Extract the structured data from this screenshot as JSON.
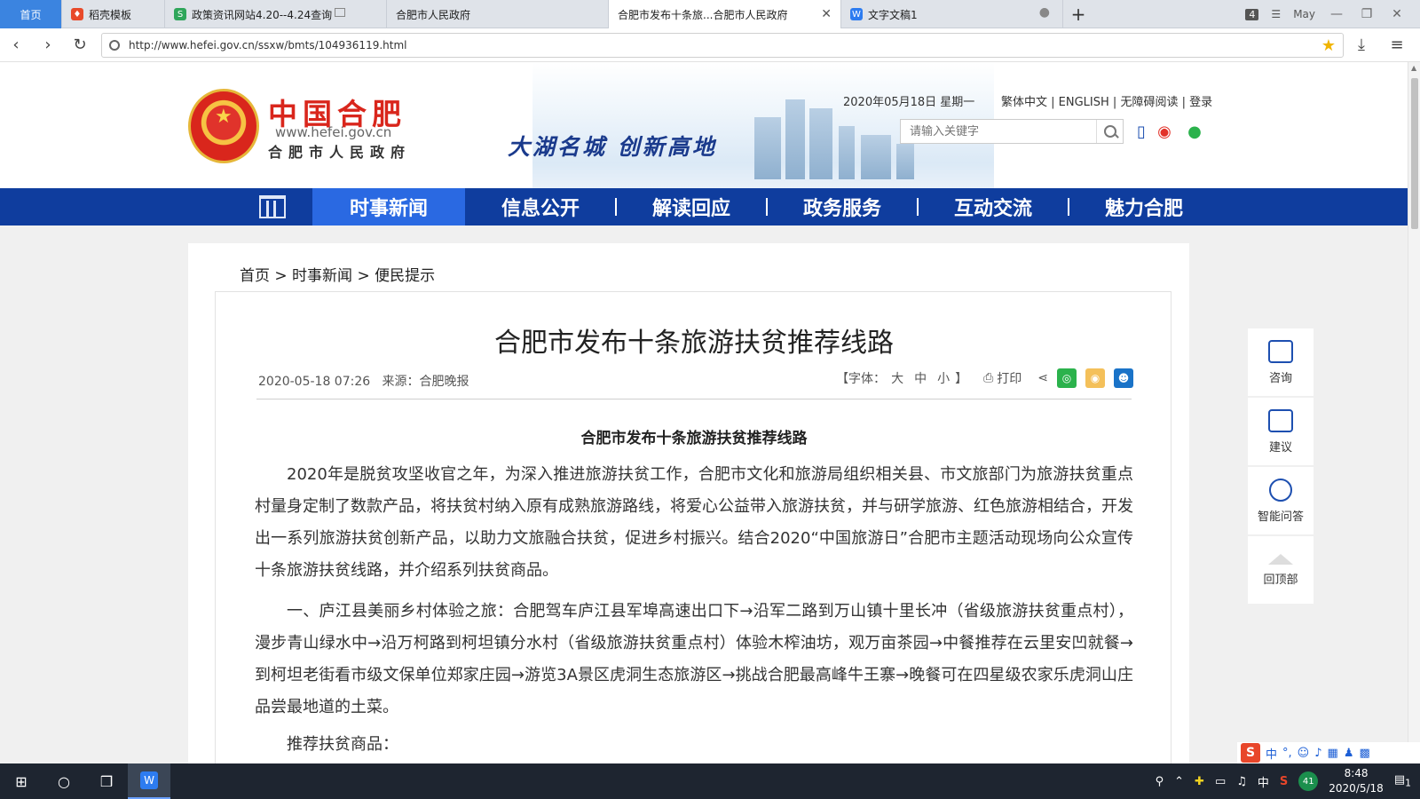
{
  "browser": {
    "tabs": [
      {
        "label": "首页",
        "icon": "home-tab",
        "color": "#3b84e0"
      },
      {
        "label": "稻壳模板",
        "icon": "docer-icon",
        "color": "#e84a2a"
      },
      {
        "label": "政策资讯网站4.20--4.24查询",
        "icon": "sheet-icon",
        "color": "#2fa65b"
      },
      {
        "label": "合肥市人民政府",
        "icon": "page-icon",
        "color": ""
      },
      {
        "label": "合肥市发布十条旅...合肥市人民政府",
        "icon": "page-icon",
        "color": ""
      },
      {
        "label": "文字文稿1",
        "icon": "wps-writer-icon",
        "color": "#2d7cf0"
      }
    ],
    "tab_count": "4",
    "user_name": "May",
    "url": "http://www.hefei.gov.cn/ssxw/bmts/104936119.html"
  },
  "site": {
    "logo_title": "中国合肥",
    "logo_url": "www.hefei.gov.cn",
    "logo_subtitle": "合肥市人民政府",
    "slogan": "大湖名城  创新高地",
    "date": "2020年05月18日 星期一",
    "links": [
      "繁体中文",
      "ENGLISH",
      "无障碍阅读",
      "登录"
    ],
    "search_placeholder": "请输入关键字",
    "nav": [
      "时事新闻",
      "信息公开",
      "解读回应",
      "政务服务",
      "互动交流",
      "魅力合肥"
    ],
    "nav_active": "时事新闻",
    "brand_blue": "#0f3d9e",
    "accent_red": "#d9261c"
  },
  "breadcrumb": "首页 > 时事新闻 > 便民提示",
  "article": {
    "title": "合肥市发布十条旅游扶贫推荐线路",
    "date": "2020-05-18 07:26",
    "source": "来源：合肥晚报",
    "font_label": "【字体：",
    "font_sizes": [
      "大",
      "中",
      "小"
    ],
    "font_end": "】",
    "print_label": "打印",
    "subtitle": "合肥市发布十条旅游扶贫推荐线路",
    "paragraphs": [
      "2020年是脱贫攻坚收官之年，为深入推进旅游扶贫工作，合肥市文化和旅游局组织相关县、市文旅部门为旅游扶贫重点村量身定制了数款产品，将扶贫村纳入原有成熟旅游路线，将爱心公益带入旅游扶贫，并与研学旅游、红色旅游相结合，开发出一系列旅游扶贫创新产品，以助力文旅融合扶贫，促进乡村振兴。结合2020“中国旅游日”合肥市主题活动现场向公众宣传十条旅游扶贫线路，并介绍系列扶贫商品。",
      "一、庐江县美丽乡村体验之旅：合肥驾车庐江县军埠高速出口下→沿军二路到万山镇十里长冲（省级旅游扶贫重点村），漫步青山绿水中→沿万柯路到柯坦镇分水村（省级旅游扶贫重点村）体验木榨油坊，观万亩茶园→中餐推荐在云里安凹就餐→到柯坦老街看市级文保单位郑家庄园→游览3A景区虎洞生态旅游区→挑战合肥最高峰牛王寨→晚餐可在四星级农家乐虎洞山庄品尝最地道的土菜。",
      "推荐扶贫商品："
    ]
  },
  "side_tools": [
    {
      "label": "咨询",
      "icon": "chat-icon"
    },
    {
      "label": "建议",
      "icon": "edit-icon"
    },
    {
      "label": "智能问答",
      "icon": "assistant-icon"
    },
    {
      "label": "回顶部",
      "icon": "back-to-top-icon"
    }
  ],
  "ime": {
    "label": "中"
  },
  "taskbar": {
    "time": "8:48",
    "date": "2020/5/18",
    "ime_indicator": "中",
    "badge": "41",
    "notification_count": "1"
  }
}
